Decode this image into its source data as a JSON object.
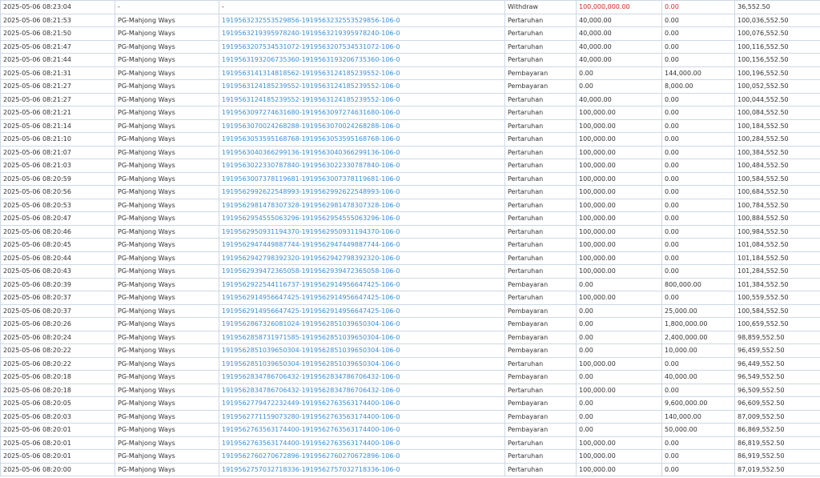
{
  "colors": {
    "link": "#3a8fd8",
    "negative": "#e02424",
    "text": "#333333",
    "border": "#cfd8e3"
  },
  "rows": [
    {
      "time": "2025-05-06 08:23:04",
      "game": "-",
      "txid": "-",
      "type": "Withdraw",
      "bet": "100,000,000.00",
      "win": "0.00",
      "balance": "36,552.50",
      "bet_neg": true,
      "win_neg": true
    },
    {
      "time": "2025-05-06 08:21:53",
      "game": "PG-Mahjong Ways",
      "txid": "1919563232553529856-1919563232553529856-106-0",
      "type": "Pertaruhan",
      "bet": "40,000.00",
      "win": "0.00",
      "balance": "100,036,552.50"
    },
    {
      "time": "2025-05-06 08:21:50",
      "game": "PG-Mahjong Ways",
      "txid": "1919563219395978240-1919563219395978240-106-0",
      "type": "Pertaruhan",
      "bet": "40,000.00",
      "win": "0.00",
      "balance": "100,076,552.50"
    },
    {
      "time": "2025-05-06 08:21:47",
      "game": "PG-Mahjong Ways",
      "txid": "1919563207534531072-1919563207534531072-106-0",
      "type": "Pertaruhan",
      "bet": "40,000.00",
      "win": "0.00",
      "balance": "100,116,552.50"
    },
    {
      "time": "2025-05-06 08:21:44",
      "game": "PG-Mahjong Ways",
      "txid": "1919563193206735360-1919563193206735360-106-0",
      "type": "Pertaruhan",
      "bet": "40,000.00",
      "win": "0.00",
      "balance": "100,156,552.50"
    },
    {
      "time": "2025-05-06 08:21:31",
      "game": "PG-Mahjong Ways",
      "txid": "1919563141314818562-1919563124185239552-106-0",
      "type": "Pembayaran",
      "bet": "0.00",
      "win": "144,000.00",
      "balance": "100,196,552.50"
    },
    {
      "time": "2025-05-06 08:21:27",
      "game": "PG-Mahjong Ways",
      "txid": "1919563124185239552-1919563124185239552-106-0",
      "type": "Pembayaran",
      "bet": "0.00",
      "win": "8,000.00",
      "balance": "100,052,552.50"
    },
    {
      "time": "2025-05-06 08:21:27",
      "game": "PG-Mahjong Ways",
      "txid": "1919563124185239552-1919563124185239552-106-0",
      "type": "Pertaruhan",
      "bet": "40,000.00",
      "win": "0.00",
      "balance": "100,044,552.50"
    },
    {
      "time": "2025-05-06 08:21:21",
      "game": "PG-Mahjong Ways",
      "txid": "1919563097274631680-1919563097274631680-106-0",
      "type": "Pertaruhan",
      "bet": "100,000.00",
      "win": "0.00",
      "balance": "100,084,552.50"
    },
    {
      "time": "2025-05-06 08:21:14",
      "game": "PG-Mahjong Ways",
      "txid": "1919563070024268288-1919563070024268288-106-0",
      "type": "Pertaruhan",
      "bet": "100,000.00",
      "win": "0.00",
      "balance": "100,184,552.50"
    },
    {
      "time": "2025-05-06 08:21:10",
      "game": "PG-Mahjong Ways",
      "txid": "1919563053595168768-1919563053595168768-106-0",
      "type": "Pertaruhan",
      "bet": "100,000.00",
      "win": "0.00",
      "balance": "100,284,552.50"
    },
    {
      "time": "2025-05-06 08:21:07",
      "game": "PG-Mahjong Ways",
      "txid": "1919563040366299136-1919563040366299136-106-0",
      "type": "Pertaruhan",
      "bet": "100,000.00",
      "win": "0.00",
      "balance": "100,384,552.50"
    },
    {
      "time": "2025-05-06 08:21:03",
      "game": "PG-Mahjong Ways",
      "txid": "1919563022330787840-1919563022330787840-106-0",
      "type": "Pertaruhan",
      "bet": "100,000.00",
      "win": "0.00",
      "balance": "100,484,552.50"
    },
    {
      "time": "2025-05-06 08:20:59",
      "game": "PG-Mahjong Ways",
      "txid": "1919563007378119681-1919563007378119681-106-0",
      "type": "Pertaruhan",
      "bet": "100,000.00",
      "win": "0.00",
      "balance": "100,584,552.50"
    },
    {
      "time": "2025-05-06 08:20:56",
      "game": "PG-Mahjong Ways",
      "txid": "1919562992622548993-1919562992622548993-106-0",
      "type": "Pertaruhan",
      "bet": "100,000.00",
      "win": "0.00",
      "balance": "100,684,552.50"
    },
    {
      "time": "2025-05-06 08:20:53",
      "game": "PG-Mahjong Ways",
      "txid": "1919562981478307328-1919562981478307328-106-0",
      "type": "Pertaruhan",
      "bet": "100,000.00",
      "win": "0.00",
      "balance": "100,784,552.50"
    },
    {
      "time": "2025-05-06 08:20:47",
      "game": "PG-Mahjong Ways",
      "txid": "1919562954555063296-1919562954555063296-106-0",
      "type": "Pertaruhan",
      "bet": "100,000.00",
      "win": "0.00",
      "balance": "100,884,552.50"
    },
    {
      "time": "2025-05-06 08:20:46",
      "game": "PG-Mahjong Ways",
      "txid": "1919562950931194370-1919562950931194370-106-0",
      "type": "Pertaruhan",
      "bet": "100,000.00",
      "win": "0.00",
      "balance": "100,984,552.50"
    },
    {
      "time": "2025-05-06 08:20:45",
      "game": "PG-Mahjong Ways",
      "txid": "1919562947449887744-1919562947449887744-106-0",
      "type": "Pertaruhan",
      "bet": "100,000.00",
      "win": "0.00",
      "balance": "101,084,552.50"
    },
    {
      "time": "2025-05-06 08:20:44",
      "game": "PG-Mahjong Ways",
      "txid": "1919562942798392320-1919562942798392320-106-0",
      "type": "Pertaruhan",
      "bet": "100,000.00",
      "win": "0.00",
      "balance": "101,184,552.50"
    },
    {
      "time": "2025-05-06 08:20:43",
      "game": "PG-Mahjong Ways",
      "txid": "1919562939472365058-1919562939472365058-106-0",
      "type": "Pertaruhan",
      "bet": "100,000.00",
      "win": "0.00",
      "balance": "101,284,552.50"
    },
    {
      "time": "2025-05-06 08:20:39",
      "game": "PG-Mahjong Ways",
      "txid": "1919562922544116737-1919562914956647425-106-0",
      "type": "Pembayaran",
      "bet": "0.00",
      "win": "800,000.00",
      "balance": "101,384,552.50"
    },
    {
      "time": "2025-05-06 08:20:37",
      "game": "PG-Mahjong Ways",
      "txid": "1919562914956647425-1919562914956647425-106-0",
      "type": "Pertaruhan",
      "bet": "100,000.00",
      "win": "0.00",
      "balance": "100,559,552.50"
    },
    {
      "time": "2025-05-06 08:20:37",
      "game": "PG-Mahjong Ways",
      "txid": "1919562914956647425-1919562914956647425-106-0",
      "type": "Pembayaran",
      "bet": "0.00",
      "win": "25,000.00",
      "balance": "100,584,552.50"
    },
    {
      "time": "2025-05-06 08:20:26",
      "game": "PG-Mahjong Ways",
      "txid": "1919562867326081024-1919562851039650304-106-0",
      "type": "Pembayaran",
      "bet": "0.00",
      "win": "1,800,000.00",
      "balance": "100,659,552.50"
    },
    {
      "time": "2025-05-06 08:20:24",
      "game": "PG-Mahjong Ways",
      "txid": "1919562858731971585-1919562851039650304-106-0",
      "type": "Pembayaran",
      "bet": "0.00",
      "win": "2,400,000.00",
      "balance": "98,859,552.50"
    },
    {
      "time": "2025-05-06 08:20:22",
      "game": "PG-Mahjong Ways",
      "txid": "1919562851039650304-1919562851039650304-106-0",
      "type": "Pembayaran",
      "bet": "0.00",
      "win": "10,000.00",
      "balance": "96,459,552.50"
    },
    {
      "time": "2025-05-06 08:20:22",
      "game": "PG-Mahjong Ways",
      "txid": "1919562851039650304-1919562851039650304-106-0",
      "type": "Pertaruhan",
      "bet": "100,000.00",
      "win": "0.00",
      "balance": "96,449,552.50"
    },
    {
      "time": "2025-05-06 08:20:18",
      "game": "PG-Mahjong Ways",
      "txid": "1919562834786706432-1919562834786706432-106-0",
      "type": "Pembayaran",
      "bet": "0.00",
      "win": "40,000.00",
      "balance": "96,549,552.50"
    },
    {
      "time": "2025-05-06 08:20:18",
      "game": "PG-Mahjong Ways",
      "txid": "1919562834786706432-1919562834786706432-106-0",
      "type": "Pertaruhan",
      "bet": "100,000.00",
      "win": "0.00",
      "balance": "96,509,552.50"
    },
    {
      "time": "2025-05-06 08:20:05",
      "game": "PG-Mahjong Ways",
      "txid": "1919562779472232449-1919562763563174400-106-0",
      "type": "Pembayaran",
      "bet": "0.00",
      "win": "9,600,000.00",
      "balance": "96,609,552.50"
    },
    {
      "time": "2025-05-06 08:20:03",
      "game": "PG-Mahjong Ways",
      "txid": "1919562771159073280-1919562763563174400-106-0",
      "type": "Pembayaran",
      "bet": "0.00",
      "win": "140,000.00",
      "balance": "87,009,552.50"
    },
    {
      "time": "2025-05-06 08:20:01",
      "game": "PG-Mahjong Ways",
      "txid": "1919562763563174400-1919562763563174400-106-0",
      "type": "Pembayaran",
      "bet": "0.00",
      "win": "50,000.00",
      "balance": "86,869,552.50"
    },
    {
      "time": "2025-05-06 08:20:01",
      "game": "PG-Mahjong Ways",
      "txid": "1919562763563174400-1919562763563174400-106-0",
      "type": "Pertaruhan",
      "bet": "100,000.00",
      "win": "0.00",
      "balance": "86,819,552.50"
    },
    {
      "time": "2025-05-06 08:20:01",
      "game": "PG-Mahjong Ways",
      "txid": "1919562760270672896-1919562760270672896-106-0",
      "type": "Pertaruhan",
      "bet": "100,000.00",
      "win": "0.00",
      "balance": "86,919,552.50"
    },
    {
      "time": "2025-05-06 08:20:00",
      "game": "PG-Mahjong Ways",
      "txid": "1919562757032718336-1919562757032718336-106-0",
      "type": "Pertaruhan",
      "bet": "100,000.00",
      "win": "0.00",
      "balance": "87,019,552.50"
    }
  ]
}
